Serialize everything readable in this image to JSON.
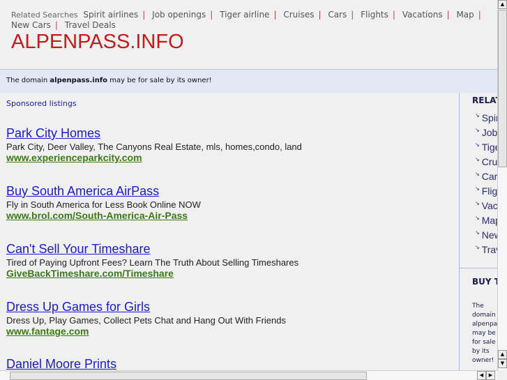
{
  "related_bar": {
    "label": "Related Searches",
    "items": [
      "Spirit airlines",
      "Job openings",
      "Tiger airline",
      "Cruises",
      "Cars",
      "Flights",
      "Vacations",
      "Map",
      "New Cars",
      "Travel Deals"
    ]
  },
  "site_title": "ALPENPASS.INFO",
  "sale_notice": {
    "prefix": "The domain ",
    "domain": "alpenpass.info",
    "suffix": " may be for sale by its owner!"
  },
  "sponsored_label": "Sponsored listings",
  "ads": [
    {
      "title": "Park City Homes",
      "desc": "Park City, Deer Valley, The Canyons Real Estate, mls, homes,condo, land",
      "url": "www.experienceparkcity.com"
    },
    {
      "title": "Buy South America AirPass",
      "desc": "Fly in South America for Less Book Online NOW",
      "url": "www.brol.com/South-America-Air-Pass"
    },
    {
      "title": "Can't Sell Your Timeshare",
      "desc": "Tired of Paying Upfront Fees? Learn The Truth About Selling Timeshares",
      "url": "GiveBackTimeshare.com/Timeshare"
    },
    {
      "title": "Dress Up Games for Girls",
      "desc": "Dress Up, Play Games, Collect Pets Chat and Hang Out With Friends",
      "url": "www.fantage.com"
    },
    {
      "title": "Daniel Moore Prints",
      "desc": "",
      "url": ""
    }
  ],
  "sidebar": {
    "heading": "RELATED SEARCHES",
    "items": [
      "Spirit airlines",
      "Job openings",
      "Tiger airline",
      "Cruises",
      "Cars",
      "Flights",
      "Vacations",
      "Map",
      "New Cars",
      "Travel Deals"
    ],
    "buy_heading": "BUY THIS DOMAIN",
    "buy_text": "The domain alpenpass.info may be for sale by its owner!"
  }
}
